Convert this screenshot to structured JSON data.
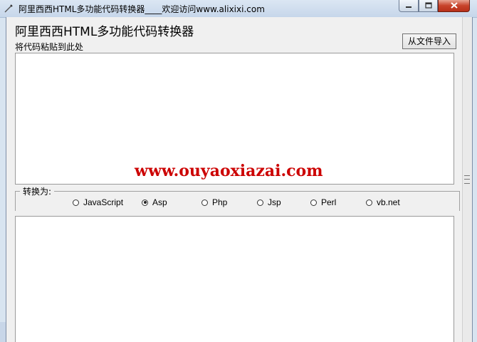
{
  "window": {
    "title": "阿里西西HTML多功能代码转换器____欢迎访问www.alixixi.com"
  },
  "header": {
    "app_title": "阿里西西HTML多功能代码转换器",
    "paste_label": "将代码粘贴到此处",
    "import_button": "从文件导入"
  },
  "watermark": "www.ouyaoxiazai.com",
  "convert": {
    "legend": "转换为:",
    "options": [
      {
        "label": "JavaScript",
        "checked": false
      },
      {
        "label": "Asp",
        "checked": true
      },
      {
        "label": "Php",
        "checked": false
      },
      {
        "label": "Jsp",
        "checked": false
      },
      {
        "label": "Perl",
        "checked": false
      },
      {
        "label": "vb.net",
        "checked": false
      }
    ]
  },
  "icons": {
    "app": "pen-icon",
    "minimize": "minimize-icon",
    "maximize": "maximize-icon",
    "close": "close-icon"
  },
  "colors": {
    "watermark": "#cc0000",
    "close_button": "#c7422a"
  }
}
